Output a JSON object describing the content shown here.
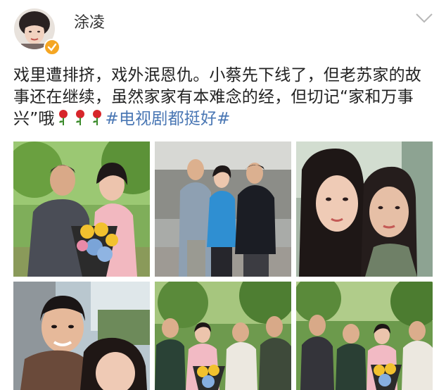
{
  "post": {
    "username": "涂凌",
    "verified_badge": "verified-icon",
    "text_line_1": "戏里遭排挤，戏外泯恩仇。小蔡先下线了，但老苏家的故",
    "text_line_2": "事还在继续，虽然家家有本难念的经，但切记“家和万事",
    "text_line_3_prefix": "兴”哦",
    "hashtag": "#电视剧都挺好#",
    "emoji": "rose-icon",
    "photos": [
      "photo-1",
      "photo-2",
      "photo-3",
      "photo-4",
      "photo-5",
      "photo-6"
    ]
  },
  "colors": {
    "hashtag": "#4a77b4",
    "verified": "#f5a623",
    "text": "#222222"
  }
}
